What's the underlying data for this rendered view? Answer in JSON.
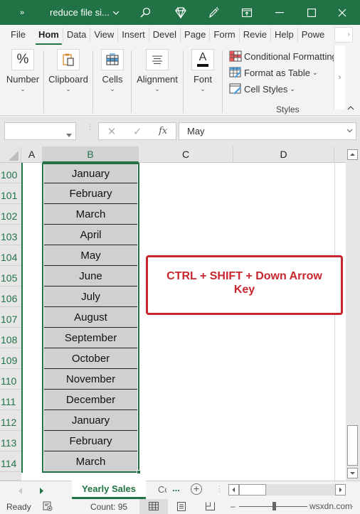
{
  "titlebar": {
    "qat_more": "»",
    "title": "reduce file si...",
    "title_chevron": "⌄",
    "search_icon": "search-icon",
    "diamond_icon": "premium-diamond-icon",
    "pen_icon": "draw-pen-icon",
    "restore_icon": "ribbon-display-icon",
    "minimize": "—",
    "maximize": "☐",
    "close": "✕",
    "color": "#217346"
  },
  "ribbon_tabs": [
    {
      "label": "File",
      "active": false
    },
    {
      "label": "Hom",
      "active": true
    },
    {
      "label": "Data",
      "active": false
    },
    {
      "label": "View",
      "active": false
    },
    {
      "label": "Insert",
      "active": false
    },
    {
      "label": "Devel",
      "active": false
    },
    {
      "label": "Page",
      "active": false
    },
    {
      "label": "Form",
      "active": false
    },
    {
      "label": "Revie",
      "active": false
    },
    {
      "label": "Help",
      "active": false
    },
    {
      "label": "Powe",
      "active": false
    }
  ],
  "ribbon": {
    "groups": [
      {
        "label": "Number",
        "icon": "%"
      },
      {
        "label": "Clipboard",
        "icon": "clipboard-icon"
      },
      {
        "label": "Cells",
        "icon": "cells-icon"
      },
      {
        "label": "Alignment",
        "icon": "alignment-icon"
      },
      {
        "label": "Font",
        "icon": "A"
      }
    ],
    "styles": {
      "conditional_formatting": "Conditional Formatting",
      "format_as_table": "Format as Table",
      "cell_styles": "Cell Styles",
      "group_label": "Styles"
    },
    "scroll_right": "›",
    "collapse": "⌃"
  },
  "formula_bar": {
    "name_box": "",
    "cancel": "✕",
    "enter": "✓",
    "fx": "fx",
    "value": "May"
  },
  "sheet": {
    "columns": [
      "A",
      "B",
      "C",
      "D"
    ],
    "selected_column": "B",
    "rows": [
      {
        "num": "100",
        "b": "January"
      },
      {
        "num": "101",
        "b": "February"
      },
      {
        "num": "102",
        "b": "March"
      },
      {
        "num": "103",
        "b": "April"
      },
      {
        "num": "104",
        "b": "May"
      },
      {
        "num": "105",
        "b": "June"
      },
      {
        "num": "106",
        "b": "July"
      },
      {
        "num": "107",
        "b": "August"
      },
      {
        "num": "108",
        "b": "September"
      },
      {
        "num": "109",
        "b": "October"
      },
      {
        "num": "110",
        "b": "November"
      },
      {
        "num": "111",
        "b": "December"
      },
      {
        "num": "112",
        "b": "January"
      },
      {
        "num": "113",
        "b": "February"
      },
      {
        "num": "114",
        "b": "March"
      }
    ],
    "callout": {
      "line1": "CTRL + SHIFT + Down Arrow",
      "line2": "Key",
      "color": "#c8262e"
    }
  },
  "sheet_tabs": {
    "active": "Yearly Sales",
    "next_truncated": "Cc",
    "more": "...",
    "add": "+"
  },
  "status": {
    "ready": "Ready",
    "count": "Count: 95",
    "watermark": "wsxdn.com"
  }
}
